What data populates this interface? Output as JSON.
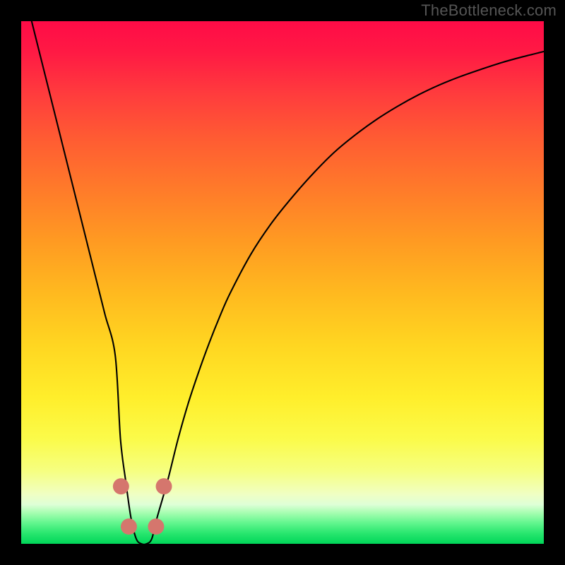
{
  "watermark": "TheBottleneck.com",
  "chart_data": {
    "type": "line",
    "title": "",
    "xlabel": "",
    "ylabel": "",
    "xlim": [
      0,
      100
    ],
    "ylim": [
      0,
      100
    ],
    "grid": false,
    "series": [
      {
        "name": "bottleneck-curve",
        "x": [
          0,
          2,
          4,
          6,
          8,
          10,
          12,
          14,
          16,
          18,
          19,
          20,
          21,
          22,
          23,
          24,
          25,
          26,
          28,
          30,
          32,
          34,
          36,
          38,
          40,
          44,
          48,
          52,
          56,
          60,
          64,
          68,
          72,
          76,
          80,
          84,
          88,
          92,
          96,
          100
        ],
        "values": [
          108,
          100,
          92,
          84,
          76,
          68,
          60,
          52,
          44,
          36,
          20,
          12,
          5,
          1,
          0,
          0,
          1,
          5,
          12,
          20,
          27,
          33,
          38.5,
          43.5,
          48,
          55.5,
          61.5,
          66.5,
          71,
          75,
          78.3,
          81.2,
          83.7,
          85.9,
          87.8,
          89.4,
          90.8,
          92.1,
          93.2,
          94.2
        ]
      }
    ],
    "markers": [
      {
        "x": 19.1,
        "y": 11.0
      },
      {
        "x": 20.6,
        "y": 3.3
      },
      {
        "x": 25.8,
        "y": 3.3
      },
      {
        "x": 27.3,
        "y": 11.0
      }
    ],
    "marker_style": {
      "color": "#d5766d",
      "radius_pct": 1.55
    }
  }
}
